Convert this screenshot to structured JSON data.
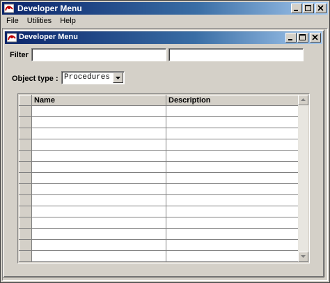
{
  "app": {
    "title": "Developer Menu"
  },
  "menubar": {
    "items": [
      "File",
      "Utilities",
      "Help"
    ]
  },
  "inner_window": {
    "title": "Developer Menu"
  },
  "filter": {
    "label": "Filter",
    "value1": "",
    "value2": ""
  },
  "object_type": {
    "label": "Object type :",
    "selected": "Procedures"
  },
  "grid": {
    "columns": [
      "Name",
      "Description"
    ],
    "row_count": 14
  },
  "icons": {
    "app": "app-icon",
    "minimize": "minimize-icon",
    "maximize": "maximize-icon",
    "close": "close-icon"
  }
}
